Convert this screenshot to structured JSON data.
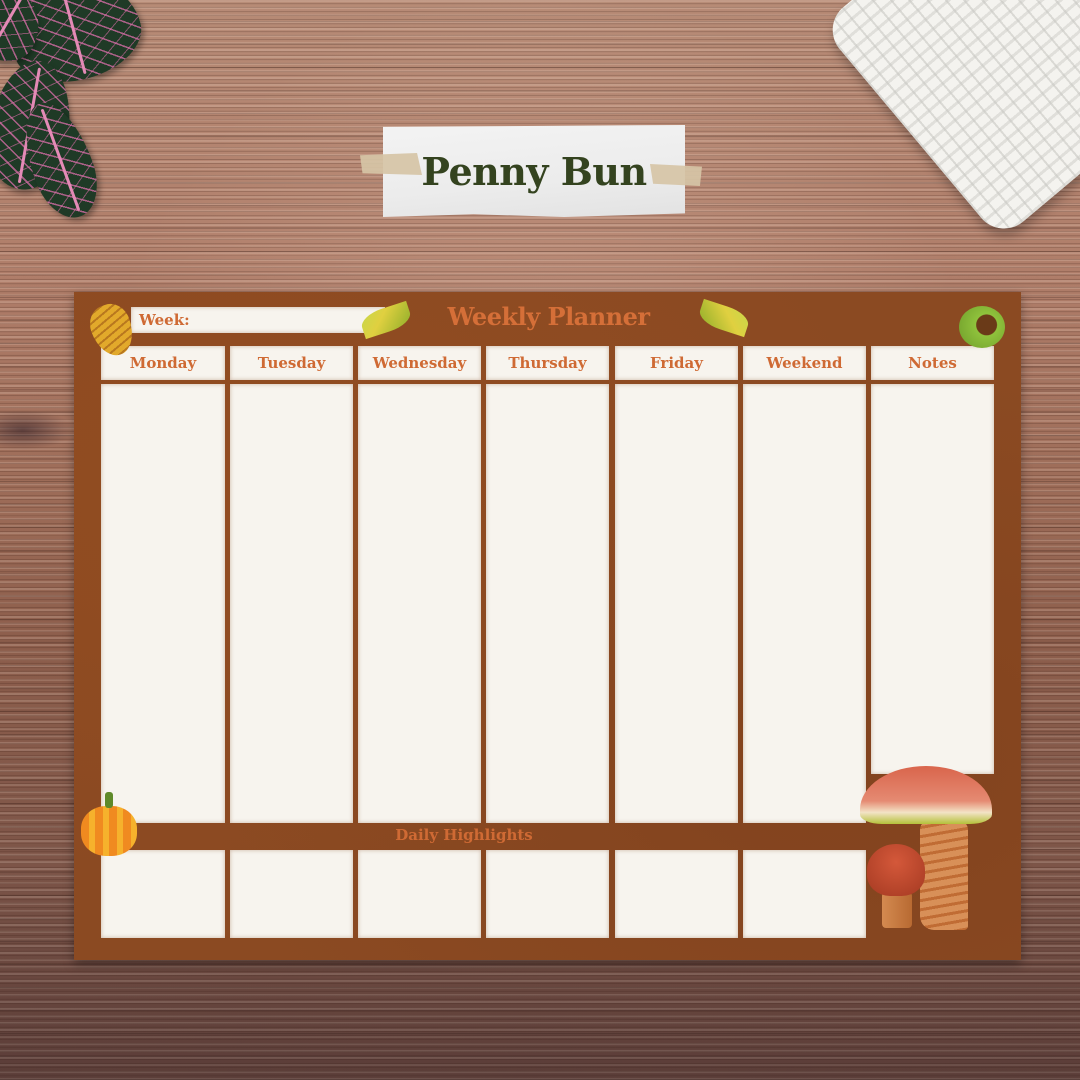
{
  "title_card": {
    "title": "Penny Bun"
  },
  "planner": {
    "title": "Weekly Planner",
    "week_label": "Week:",
    "columns": [
      {
        "label": "Monday"
      },
      {
        "label": "Tuesday"
      },
      {
        "label": "Wednesday"
      },
      {
        "label": "Thursday"
      },
      {
        "label": "Friday"
      },
      {
        "label": "Weekend"
      },
      {
        "label": "Notes"
      }
    ],
    "highlights_label": "Daily Highlights"
  },
  "decorations": {
    "background": "wood-table",
    "items": [
      "plant-icon",
      "knit-blanket",
      "pinecone-icon",
      "leaf-icon",
      "chestnut-icon",
      "pumpkin-icon",
      "mushroom-icon"
    ]
  },
  "colors": {
    "planner_brown": "#8b4a22",
    "accent_orange": "#cf6a34",
    "title_green": "#34431f",
    "paper": "#f7f4ee"
  }
}
